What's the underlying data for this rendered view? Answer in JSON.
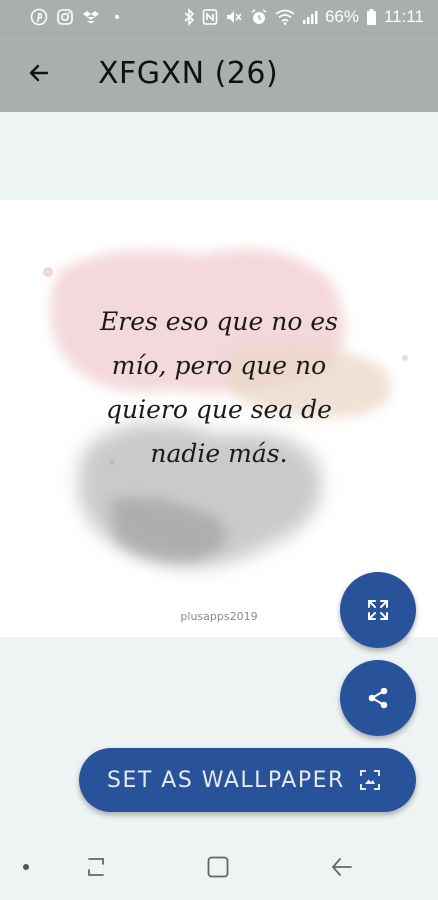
{
  "status_bar": {
    "battery_percent": "66%",
    "time": "11:11",
    "icons": [
      "pinterest-icon",
      "instagram-icon",
      "dropbox-icon",
      "notification-dot-icon",
      "bluetooth-icon",
      "nfc-icon",
      "mute-icon",
      "alarm-icon",
      "wifi-icon",
      "signal-icon",
      "battery-icon"
    ]
  },
  "app_bar": {
    "title": "XFGXN (26)",
    "back_icon": "arrow-back-icon"
  },
  "wallpaper": {
    "quote_lines": [
      "Eres eso que no es",
      "mío, pero que no",
      "quiero que sea de",
      "nadie más."
    ],
    "watermark": "plusapps2019"
  },
  "actions": {
    "expand_icon": "fullscreen-icon",
    "share_icon": "share-icon",
    "set_wallpaper_label": "SET AS WALLPAPER",
    "set_wallpaper_icon": "wallpaper-icon"
  },
  "nav_bar": {
    "icons": [
      "dot-icon",
      "recents-icon",
      "home-icon",
      "back-icon"
    ]
  },
  "colors": {
    "app_bar": "#a9aeae",
    "accent": "#28539a",
    "background": "#eef3f3"
  }
}
